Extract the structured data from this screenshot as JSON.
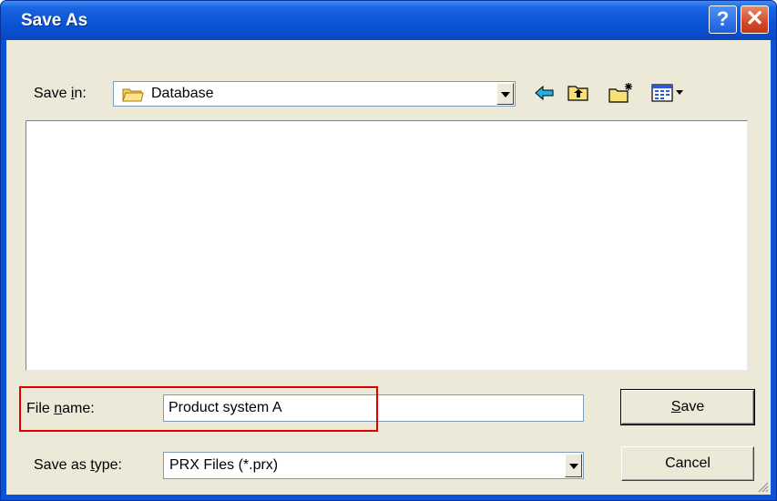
{
  "window": {
    "title": "Save As"
  },
  "titlebar": {
    "help_label": "?",
    "close_label": "✕"
  },
  "save_in": {
    "label_pre": "Save ",
    "label_accel": "i",
    "label_post": "n:",
    "value": "Database",
    "icon": "folder-icon"
  },
  "toolbar": {
    "items": [
      {
        "name": "back-button",
        "icon": "back-arrow-icon"
      },
      {
        "name": "up-one-level-button",
        "icon": "folder-up-icon"
      },
      {
        "name": "create-new-folder-button",
        "icon": "new-folder-icon"
      },
      {
        "name": "view-menu-button",
        "icon": "view-menu-icon"
      }
    ]
  },
  "file_name": {
    "label_pre": "File ",
    "label_accel": "n",
    "label_post": "ame:",
    "value": "Product system A"
  },
  "save_as_type": {
    "label_pre": "Save as ",
    "label_accel": "t",
    "label_post": "ype:",
    "value": "PRX Files (*.prx)"
  },
  "buttons": {
    "save_accel": "S",
    "save_rest": "ave",
    "cancel": "Cancel"
  },
  "colors": {
    "title_bar": "#0c55d6",
    "dialog_face": "#ece9d8",
    "highlight": "#e00000"
  }
}
